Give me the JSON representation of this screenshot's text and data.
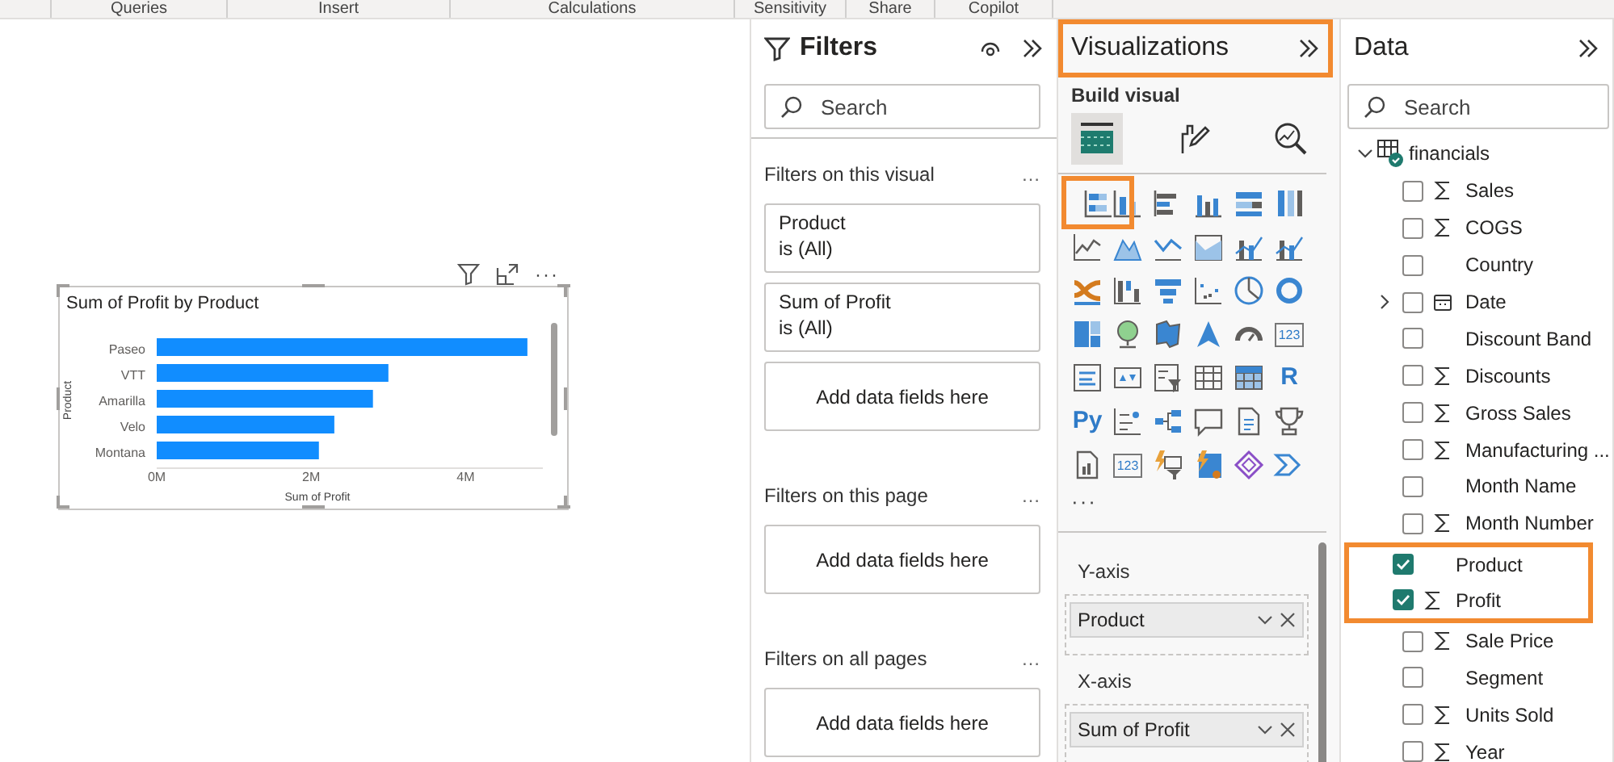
{
  "ribbon": {
    "groups": [
      "Queries",
      "Insert",
      "Calculations",
      "Sensitivity",
      "Share",
      "Copilot"
    ]
  },
  "report_canvas": {
    "visual": {
      "more": "···",
      "chart_data": {
        "type": "bar",
        "orientation": "horizontal",
        "title": "Sum of Profit by Product",
        "xlabel": "Sum of Profit",
        "ylabel": "Product",
        "categories": [
          "Paseo",
          "VTT",
          "Amarilla",
          "Velo",
          "Montana"
        ],
        "series": [
          {
            "color": "#118dff",
            "values": [
              4800000,
              3000000,
              2800000,
              2300000,
              2100000
            ]
          }
        ],
        "xlim": [
          0,
          5000000
        ],
        "xticks": [
          {
            "value": 0,
            "label": "0M"
          },
          {
            "value": 2000000,
            "label": "2M"
          },
          {
            "value": 4000000,
            "label": "4M"
          }
        ]
      }
    }
  },
  "filters_pane": {
    "title": "Filters",
    "search": {
      "placeholder": "Search"
    },
    "sections": [
      {
        "title": "Filters on this visual",
        "more": "…",
        "cards": [
          {
            "kind": "filter",
            "field": "Product",
            "condition": "is (All)"
          },
          {
            "kind": "filter",
            "field": "Sum of Profit",
            "condition": "is (All)"
          },
          {
            "kind": "drop",
            "text": "Add data fields here"
          }
        ]
      },
      {
        "title": "Filters on this page",
        "more": "…",
        "cards": [
          {
            "kind": "drop",
            "text": "Add data fields here"
          }
        ]
      },
      {
        "title": "Filters on all pages",
        "more": "…",
        "cards": [
          {
            "kind": "drop",
            "text": "Add data fields here"
          }
        ]
      }
    ]
  },
  "visualizations_pane": {
    "title": "Visualizations",
    "highlighted": true,
    "subtitle": "Build visual",
    "build_tabs": [
      {
        "kind": "fields",
        "selected": true
      },
      {
        "kind": "format",
        "selected": false
      },
      {
        "kind": "analytics",
        "selected": false
      }
    ],
    "visual_types": [
      {
        "kind": "hbar-stacked",
        "selected": true
      },
      {
        "kind": "vbar-stacked",
        "selected": false
      },
      {
        "kind": "hbar",
        "selected": false
      },
      {
        "kind": "vbar",
        "selected": false
      },
      {
        "kind": "hbar-100",
        "selected": false
      },
      {
        "kind": "vbar-100",
        "selected": false
      },
      {
        "kind": "line",
        "selected": false
      },
      {
        "kind": "area",
        "selected": false
      },
      {
        "kind": "area-stacked",
        "selected": false
      },
      {
        "kind": "area-100",
        "selected": false
      },
      {
        "kind": "line-column",
        "selected": false
      },
      {
        "kind": "line-column",
        "selected": false
      },
      {
        "kind": "ribbon",
        "selected": false
      },
      {
        "kind": "waterfall",
        "selected": false
      },
      {
        "kind": "funnel",
        "selected": false
      },
      {
        "kind": "scatter",
        "selected": false
      },
      {
        "kind": "pie",
        "selected": false
      },
      {
        "kind": "donut",
        "selected": false
      },
      {
        "kind": "treemap",
        "selected": false
      },
      {
        "kind": "globe",
        "selected": false
      },
      {
        "kind": "filled-map",
        "selected": false
      },
      {
        "kind": "arrow",
        "selected": false
      },
      {
        "kind": "gauge",
        "selected": false
      },
      {
        "kind": "glyph-box",
        "glyph": "123",
        "selected": false
      },
      {
        "kind": "multirow-card",
        "selected": false
      },
      {
        "kind": "kpi",
        "selected": false
      },
      {
        "kind": "slicer",
        "selected": false
      },
      {
        "kind": "table",
        "selected": false
      },
      {
        "kind": "matrix",
        "selected": false
      },
      {
        "kind": "glyph",
        "glyph": "R",
        "selected": false
      },
      {
        "kind": "glyph",
        "glyph": "Py",
        "selected": false
      },
      {
        "kind": "influencers",
        "selected": false
      },
      {
        "kind": "decomposition",
        "selected": false
      },
      {
        "kind": "speech-bubble",
        "selected": false
      },
      {
        "kind": "narrative",
        "selected": false
      },
      {
        "kind": "trophy",
        "selected": false
      },
      {
        "kind": "paginated",
        "selected": false
      },
      {
        "kind": "glyph-box",
        "glyph": "123",
        "selected": false
      },
      {
        "kind": "bolt-filter",
        "selected": false
      },
      {
        "kind": "bolt-map",
        "selected": false
      },
      {
        "kind": "diamond",
        "selected": false
      },
      {
        "kind": "chevrons",
        "selected": false
      }
    ],
    "more": "···",
    "wells": [
      {
        "label": "Y-axis",
        "fields": [
          "Product"
        ]
      },
      {
        "label": "X-axis",
        "fields": [
          "Sum of Profit"
        ]
      }
    ]
  },
  "data_pane": {
    "title": "Data",
    "search": {
      "placeholder": "Search"
    },
    "tables": [
      {
        "name": "financials",
        "expanded": true,
        "fields": [
          {
            "name": "Sales",
            "kind": "sum",
            "checked": false,
            "highlighted": false
          },
          {
            "name": "COGS",
            "kind": "sum",
            "checked": false,
            "highlighted": false
          },
          {
            "name": "Country",
            "kind": "plain",
            "checked": false,
            "highlighted": false
          },
          {
            "name": "Date",
            "kind": "date",
            "checked": false,
            "highlighted": false,
            "expanded": false
          },
          {
            "name": "Discount Band",
            "kind": "plain",
            "checked": false,
            "highlighted": false
          },
          {
            "name": "Discounts",
            "kind": "sum",
            "checked": false,
            "highlighted": false
          },
          {
            "name": "Gross Sales",
            "kind": "sum",
            "checked": false,
            "highlighted": false
          },
          {
            "name": "Manufacturing ...",
            "kind": "sum",
            "checked": false,
            "highlighted": false
          },
          {
            "name": "Month Name",
            "kind": "plain",
            "checked": false,
            "highlighted": false
          },
          {
            "name": "Month Number",
            "kind": "sum",
            "checked": false,
            "highlighted": false
          },
          {
            "name": "Product",
            "kind": "plain",
            "checked": true,
            "highlighted": true
          },
          {
            "name": "Profit",
            "kind": "sum",
            "checked": true,
            "highlighted": true
          },
          {
            "name": "Sale Price",
            "kind": "sum",
            "checked": false,
            "highlighted": false
          },
          {
            "name": "Segment",
            "kind": "plain",
            "checked": false,
            "highlighted": false
          },
          {
            "name": "Units Sold",
            "kind": "sum",
            "checked": false,
            "highlighted": false
          },
          {
            "name": "Year",
            "kind": "sum",
            "checked": false,
            "highlighted": false
          }
        ]
      }
    ]
  }
}
